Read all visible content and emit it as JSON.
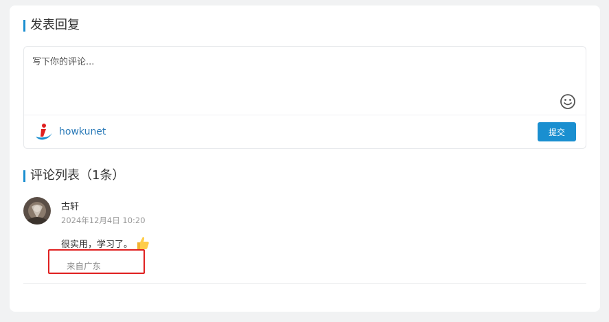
{
  "reply_section": {
    "title": "发表回复",
    "placeholder": "写下你的评论...",
    "username": "howkunet",
    "submit_label": "提交"
  },
  "comments_section": {
    "title": "评论列表（1条）",
    "comments": [
      {
        "author": "古轩",
        "time": "2024年12月4日 10:20",
        "text": "很实用，学习了。",
        "location": "来自广东"
      }
    ]
  },
  "colors": {
    "accent": "#1a8fd0",
    "highlight": "#e02020"
  }
}
